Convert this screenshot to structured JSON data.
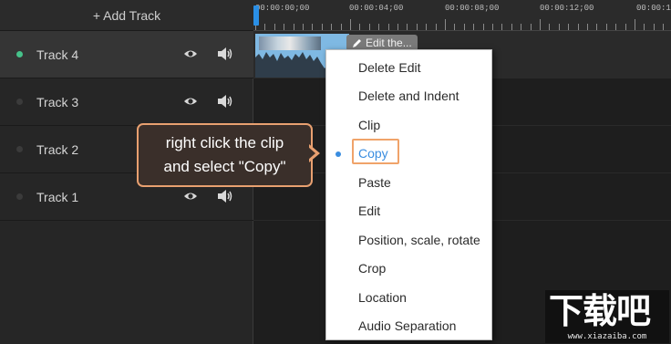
{
  "add_track": {
    "label": "+ Add Track"
  },
  "tracks": [
    {
      "name": "Track 4",
      "active": true
    },
    {
      "name": "Track 3",
      "active": false
    },
    {
      "name": "Track 2",
      "active": false
    },
    {
      "name": "Track 1",
      "active": false
    }
  ],
  "ruler": {
    "labels": [
      "00:00:00;00",
      "00:00:04;00",
      "00:00:08;00",
      "00:00:12;00",
      "00:00:1"
    ]
  },
  "clip": {
    "edit_label": "Edit the..."
  },
  "context_menu": {
    "items": [
      "Delete Edit",
      "Delete and Indent",
      "Clip",
      "Copy",
      "Paste",
      "Edit",
      "Position, scale, rotate",
      "Crop",
      "Location",
      "Audio Separation"
    ],
    "selected": "Copy"
  },
  "callout": {
    "line1": "right click the clip",
    "line2": "and select \"Copy\""
  },
  "watermark": {
    "logo": "下载吧",
    "url": "www.xiazaiba.com"
  },
  "colors": {
    "accent": "#3a8de0",
    "active_dot": "#46c28a",
    "callout_border": "#e8a070",
    "clip": "#7fb9e3"
  },
  "icons": {
    "visibility": "eye-icon",
    "audio": "speaker-icon",
    "edit": "pencil-icon"
  }
}
